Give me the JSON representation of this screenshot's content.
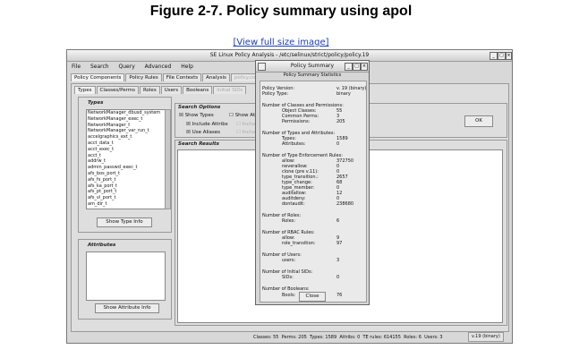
{
  "figure": {
    "title": "Figure 2-7. Policy summary using apol",
    "link": "[View full size image]"
  },
  "window": {
    "title": "SE Linux Policy Analysis - /etc/selinux/strict/policy/policy.19",
    "menu": [
      "File",
      "Search",
      "Query",
      "Advanced",
      "Help"
    ],
    "top_tabs": [
      {
        "label": "Policy Components",
        "enabled": true
      },
      {
        "label": "Policy Rules",
        "enabled": true
      },
      {
        "label": "File Contexts",
        "enabled": true
      },
      {
        "label": "Analysis",
        "enabled": true
      },
      {
        "label": "policy.conf",
        "enabled": false
      }
    ],
    "sub_tabs": [
      {
        "label": "Types",
        "enabled": true
      },
      {
        "label": "Classes/Perms",
        "enabled": true
      },
      {
        "label": "Roles",
        "enabled": true
      },
      {
        "label": "Users",
        "enabled": true
      },
      {
        "label": "Booleans",
        "enabled": true
      },
      {
        "label": "Initial SIDs",
        "enabled": false
      }
    ],
    "types_group": "Types",
    "types_list": [
      "NetworkManager_dbusd_system",
      "NetworkManager_exec_t",
      "NetworkManager_t",
      "NetworkManager_var_run_t",
      "accelgraphics_ext_t",
      "acct_data_t",
      "acct_exec_t",
      "acct_t",
      "addrw_t",
      "admin_passwd_exec_t",
      "afs_bos_port_t",
      "afs_fs_port_t",
      "afs_ka_port_t",
      "afs_pt_port_t",
      "afs_vl_port_t",
      "am_dir_t"
    ],
    "show_type_info": "Show Type Info",
    "attributes_group": "Attributes",
    "show_attr_info": "Show Attribute Info",
    "search_options_title": "Search Options",
    "opt_show_types": "Show Types",
    "opt_include_attribs": "Include Attribs",
    "opt_use_aliases": "Use Aliases",
    "opt_show_attribs": "Show Attri",
    "opt_include_1": "Include",
    "opt_include_2": "Include",
    "ok_label": "OK",
    "search_results_title": "Search Results",
    "status": [
      "Classes: 55",
      "Perms: 205",
      "Types: 1589",
      "Attribs: 0",
      "TE rules: 614155",
      "Roles: 6",
      "Users: 3"
    ],
    "version": "v.19 (binary)"
  },
  "dialog": {
    "title": "Policy Summary",
    "subtitle": "Policy Summary Statistics",
    "policy_version_label": "Policy Version:",
    "policy_version": "v. 19 (binary)",
    "policy_type_label": "Policy Type:",
    "policy_type": "binary",
    "classes_header": "Number of Classes and Permissions:",
    "object_classes_label": "Object Classes:",
    "object_classes": "55",
    "common_perms_label": "Common Perms:",
    "common_perms": "3",
    "permissions_label": "Permissions:",
    "permissions": "205",
    "types_header": "Number of Types and Attributes:",
    "types_label": "Types:",
    "types": "1589",
    "attributes_label": "Attributes:",
    "attributes": "0",
    "te_header": "Number of Type Enforcement Rules:",
    "allow_label": "allow:",
    "allow": "372750",
    "neverallow_label": "neverallow:",
    "neverallow": "0",
    "clone_label": "clone (pre v.11):",
    "clone": "0",
    "type_transition_label": "type_transition.:",
    "type_transition": "2657",
    "type_change_label": "type_change:",
    "type_change": "68",
    "type_member_label": "type_member:",
    "type_member": "0",
    "auditallow_label": "auditallow:",
    "auditallow": "12",
    "auditdeny_label": "auditdeny:",
    "auditdeny": "0",
    "dontaudit_label": "dontaudit:",
    "dontaudit": "238680",
    "roles_header": "Number of Roles:",
    "roles_label": "Roles:",
    "roles": "6",
    "rbac_header": "Number of RBAC Rules:",
    "rbac_allow_label": "allow:",
    "rbac_allow": "9",
    "role_transition_label": "role_transition:",
    "role_transition": "97",
    "users_header": "Number of Users:",
    "users_label": "users:",
    "users": "3",
    "sids_header": "Number of Initial SIDs:",
    "sids_label": "SIDs:",
    "sids": "0",
    "booleans_header": "Number of Booleans:",
    "bools_label": "Bools:",
    "bools": "76",
    "close_label": "Close"
  }
}
